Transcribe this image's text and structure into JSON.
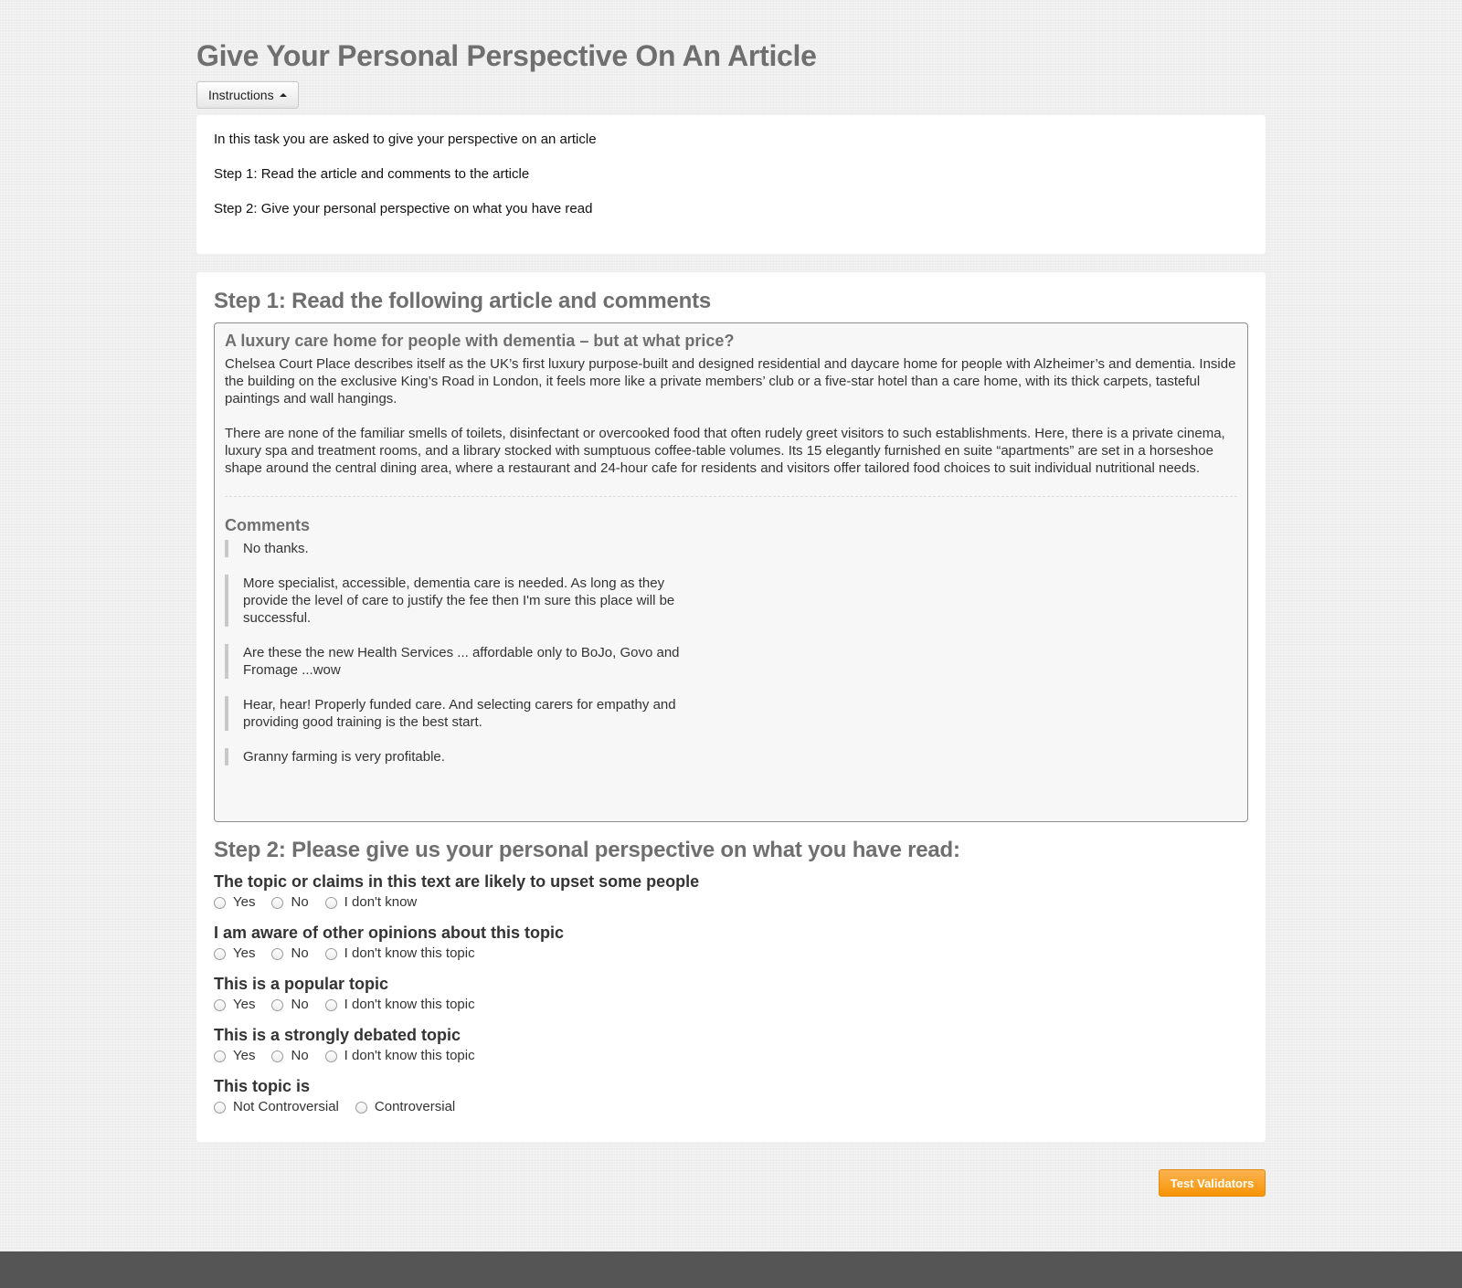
{
  "page": {
    "title": "Give Your Personal Perspective On An Article"
  },
  "instructions": {
    "button_label": "Instructions",
    "lines": [
      "In this task you are asked to give your perspective on an article",
      "Step 1: Read the article and comments to the article",
      "Step 2: Give your personal perspective on what you have read"
    ]
  },
  "step1": {
    "heading": "Step 1: Read the following article and comments",
    "article": {
      "title": "A luxury care home for people with dementia – but at what price?",
      "paragraphs": [
        "Chelsea Court Place describes itself as the UK’s first luxury purpose-built and designed residential and daycare home for people with Alzheimer’s and dementia. Inside the building on the exclusive King’s Road in London, it feels more like a private members’ club or a five-star hotel than a care home, with its thick carpets, tasteful paintings and wall hangings.",
        "There are none of the familiar smells of toilets, disinfectant or overcooked food that often rudely greet visitors to such establishments. Here, there is a private cinema, luxury spa and treatment rooms, and a library stocked with sumptuous coffee-table volumes. Its 15 elegantly furnished en suite “apartments” are set in a horseshoe shape around the central dining area, where a restaurant and 24-hour cafe for residents and visitors offer tailored food choices to suit individual nutritional needs."
      ]
    },
    "comments_heading": "Comments",
    "comments": [
      "No thanks.",
      "More specialist, accessible, dementia care is needed. As long as they provide the level of care to justify the fee then I'm sure this place will be successful.",
      "Are these the new Health Services ... affordable only to BoJo, Govo and Fromage ...wow",
      "Hear, hear! Properly funded care. And selecting carers for empathy and providing good training is the best start.",
      "Granny farming is very profitable."
    ]
  },
  "step2": {
    "heading": "Step 2: Please give us your personal perspective on what you have read:",
    "questions": [
      {
        "label": "The topic or claims in this text are likely to upset some people",
        "options": [
          "Yes",
          "No",
          "I don't know"
        ]
      },
      {
        "label": "I am aware of other opinions about this topic",
        "options": [
          "Yes",
          "No",
          "I don't know this topic"
        ]
      },
      {
        "label": "This is a popular topic",
        "options": [
          "Yes",
          "No",
          "I don't know this topic"
        ]
      },
      {
        "label": "This is a strongly debated topic",
        "options": [
          "Yes",
          "No",
          "I don't know this topic"
        ]
      },
      {
        "label": "This topic is",
        "options": [
          "Not Controversial",
          "Controversial"
        ]
      }
    ]
  },
  "actions": {
    "test_validators_label": "Test Validators"
  },
  "colors": {
    "accent_button": "#f89406",
    "heading_gray": "#6f6f6f",
    "footer": "#555555"
  },
  "icons": {
    "instructions_caret": "caret-up-icon",
    "radio": "radio-unchecked-icon"
  }
}
